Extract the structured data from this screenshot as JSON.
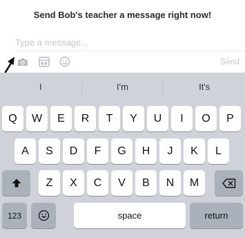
{
  "header": {
    "title": "Send Bob's teacher a message right now!"
  },
  "composer": {
    "placeholder": "Type a message...",
    "value": "",
    "send_label": "Send",
    "tools": [
      {
        "icon": "camera-icon"
      },
      {
        "icon": "image-gallery-icon"
      },
      {
        "icon": "smiley-icon"
      }
    ]
  },
  "annotation": {
    "icon": "pointer-arrow-icon"
  },
  "keyboard": {
    "predictions": [
      "I",
      "I'm",
      "It's"
    ],
    "row1": [
      "Q",
      "W",
      "E",
      "R",
      "T",
      "Y",
      "U",
      "I",
      "O",
      "P"
    ],
    "row2": [
      "A",
      "S",
      "D",
      "F",
      "G",
      "H",
      "J",
      "K",
      "L"
    ],
    "row3": [
      "Z",
      "X",
      "C",
      "V",
      "B",
      "N",
      "M"
    ],
    "shift_icon": "shift-arrow-icon",
    "backspace_icon": "backspace-icon",
    "numbers_label": "123",
    "emoji_icon": "emoji-icon",
    "space_label": "space",
    "return_label": "return"
  },
  "colors": {
    "keyboard_bg": "#cfd3d9",
    "key_light": "#ffffff",
    "key_dark": "#abb1ba",
    "placeholder": "#c7c7cc",
    "tool_icon": "#b7b7bd"
  }
}
